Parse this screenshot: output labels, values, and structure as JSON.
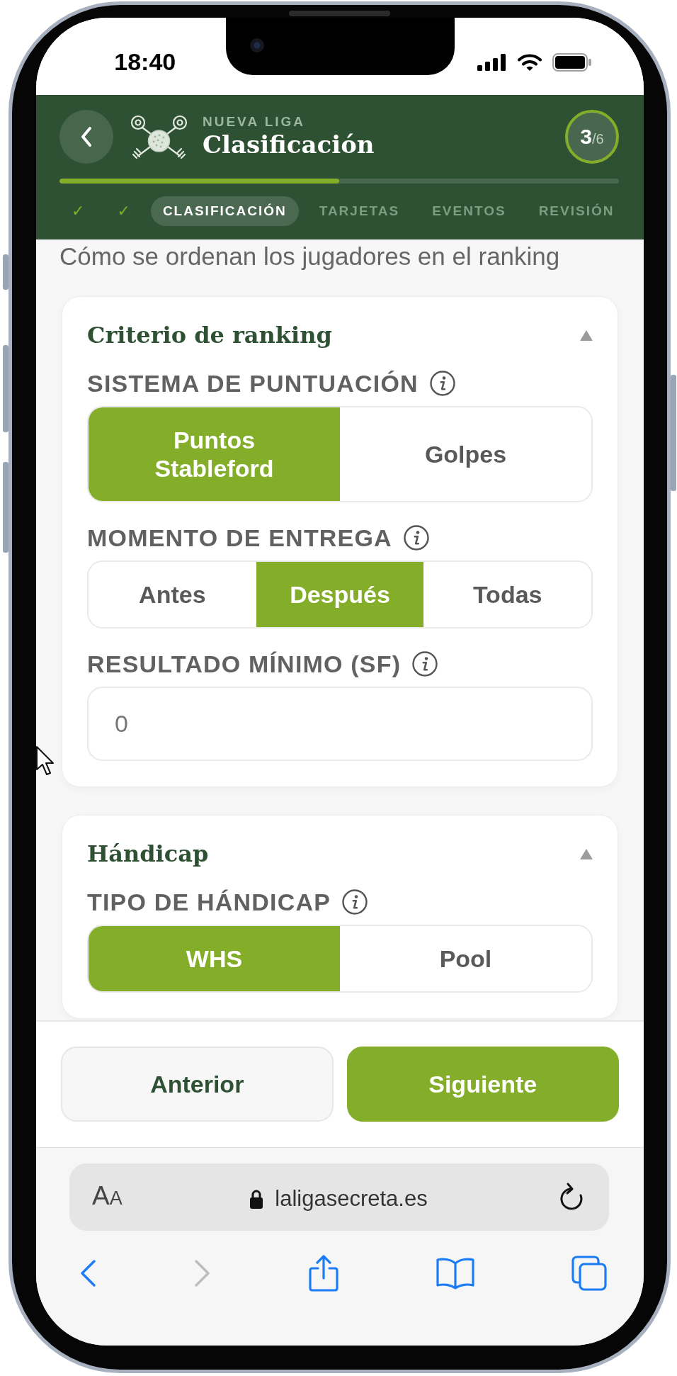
{
  "status_bar": {
    "time": "18:40"
  },
  "header": {
    "eyebrow": "NUEVA LIGA",
    "title": "Clasificación",
    "step_badge": {
      "current": "3",
      "total": "/6"
    },
    "progress": {
      "level": 0.5
    },
    "steps": [
      {
        "label": "✓",
        "done": true,
        "selected": false
      },
      {
        "label": "✓",
        "done": true,
        "selected": false
      },
      {
        "label": "CLASIFICACIÓN",
        "done": false,
        "selected": true
      },
      {
        "label": "TARJETAS",
        "done": false,
        "selected": false
      },
      {
        "label": "EVENTOS",
        "done": false,
        "selected": false
      },
      {
        "label": "REVISIÓN",
        "done": false,
        "selected": false
      }
    ]
  },
  "subtitle": "Cómo se ordenan los jugadores en el ranking",
  "sections": [
    {
      "title": "Criterio de ranking",
      "expanded": true,
      "fields": [
        {
          "kind": "segmented",
          "label": "SISTEMA DE PUNTUACIÓN",
          "options": [
            {
              "label": "Puntos Stableford",
              "selected": true
            },
            {
              "label": "Golpes",
              "selected": false
            }
          ]
        },
        {
          "kind": "segmented",
          "label": "MOMENTO DE ENTREGA",
          "options": [
            {
              "label": "Antes",
              "selected": false
            },
            {
              "label": "Después",
              "selected": true
            },
            {
              "label": "Todas",
              "selected": false
            }
          ]
        },
        {
          "kind": "input",
          "label": "RESULTADO MÍNIMO (SF)",
          "value": "0"
        }
      ]
    },
    {
      "title": "Hándicap",
      "expanded": true,
      "fields": [
        {
          "kind": "segmented",
          "label": "TIPO DE HÁNDICAP",
          "options": [
            {
              "label": "WHS",
              "selected": true
            },
            {
              "label": "Pool",
              "selected": false
            }
          ]
        }
      ]
    }
  ],
  "footer_buttons": [
    {
      "label": "Anterior",
      "kind": "secondary"
    },
    {
      "label": "Siguiente",
      "kind": "primary"
    }
  ],
  "browser": {
    "text_size_button": "AA",
    "url": "laligasecreta.es",
    "toolbar": [
      {
        "kind": "back",
        "disabled": false
      },
      {
        "kind": "forward",
        "disabled": true
      },
      {
        "kind": "share",
        "disabled": false
      },
      {
        "kind": "bookmarks",
        "disabled": false
      },
      {
        "kind": "tabs",
        "disabled": false
      }
    ]
  }
}
